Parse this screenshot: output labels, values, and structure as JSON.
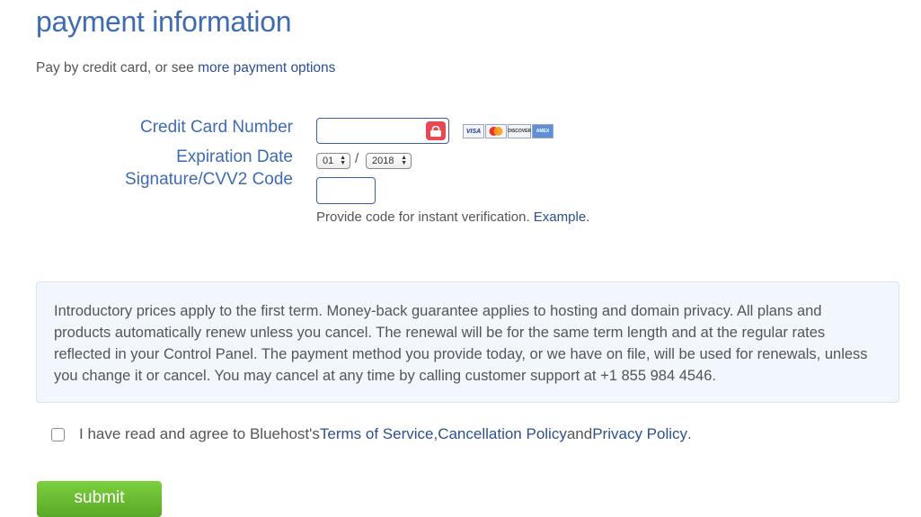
{
  "header": {
    "title": "payment information"
  },
  "payment": {
    "intro_text": "Pay by credit card, or see ",
    "more_options_link": "more payment options"
  },
  "form": {
    "cc_label": "Credit Card Number",
    "cc_value": "",
    "cards": [
      "VISA",
      "MasterCard",
      "DISCOVER",
      "AMERICAN EXPRESS"
    ],
    "expiration_label": "Expiration Date",
    "month_value": "01",
    "separator": "/",
    "year_value": "2018",
    "cvv_label": "Signature/CVV2 Code",
    "cvv_value": "",
    "hint_text": "Provide code for instant verification. ",
    "example_link": "Example."
  },
  "notice": {
    "text": "Introductory prices apply to the first term. Money-back guarantee applies to hosting and domain privacy. All plans and products automatically renew unless you cancel. The renewal will be for the same term length and at the regular rates reflected in your Control Panel. The payment method you provide today, or we have on file, will be used for renewals, unless you change it or cancel. You may cancel at any time by calling customer support at +1 855 984 4546."
  },
  "agreement": {
    "prefix": "I have read and agree to Bluehost's ",
    "tos_link": "Terms of Service",
    "comma": ", ",
    "cancellation_link": "Cancellation Policy",
    "and_text": " and ",
    "privacy_link": "Privacy Policy",
    "period": "."
  },
  "submit_label": "submit",
  "colors": {
    "title": "#3e6bb2",
    "link": "#2d4f8f",
    "submit": "#6bbf33",
    "lock": "#e84852"
  },
  "icons": {
    "lock": "lock-icon",
    "cards": "credit-card-logos"
  }
}
